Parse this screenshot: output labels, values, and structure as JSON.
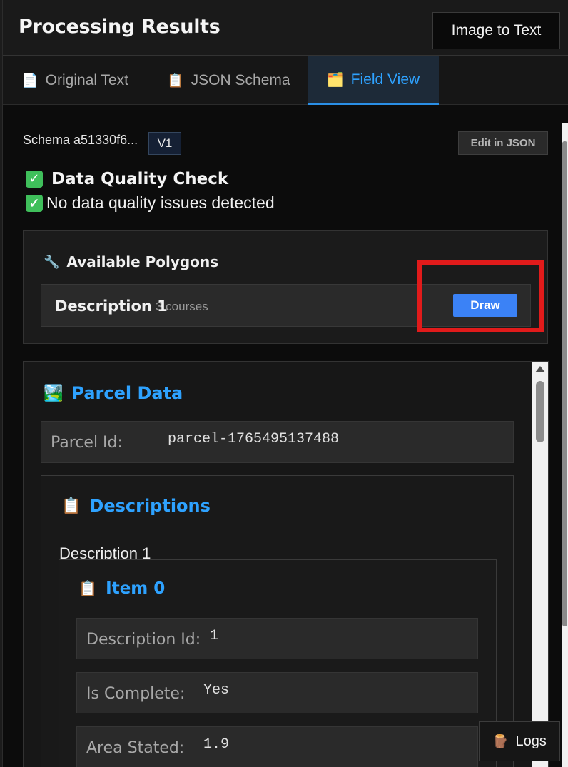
{
  "header": {
    "title": "Processing Results",
    "image_to_text_label": "Image to Text"
  },
  "tabs": [
    {
      "label": "Original Text",
      "icon": "document-icon",
      "active": false
    },
    {
      "label": "JSON Schema",
      "icon": "clipboard-icon",
      "active": false
    },
    {
      "label": "Field View",
      "icon": "folder-icon",
      "active": true
    }
  ],
  "schema": {
    "name": "Schema a51330f6...",
    "version": "V1",
    "edit_label": "Edit in JSON"
  },
  "data_quality": {
    "title": "Data Quality Check",
    "message": "No data quality issues detected"
  },
  "polygons": {
    "title": "Available Polygons",
    "items": [
      {
        "name": "Description 1",
        "courses": "3 courses",
        "action_label": "Draw"
      }
    ]
  },
  "parcel": {
    "title": "Parcel Data",
    "parcel_id_label": "Parcel Id:",
    "parcel_id_value": "parcel-1765495137488",
    "descriptions_title": "Descriptions",
    "description_label": "Description 1",
    "item_title": "Item 0",
    "fields": [
      {
        "label": "Description Id:",
        "value": "1"
      },
      {
        "label": "Is Complete:",
        "value": "Yes"
      },
      {
        "label": "Area Stated:",
        "value": "1.9"
      }
    ]
  },
  "logs_label": "Logs",
  "colors": {
    "accent": "#2ea2ff",
    "draw_button": "#3b82f6",
    "highlight": "#e11b1b",
    "check": "#3fbf5b"
  }
}
